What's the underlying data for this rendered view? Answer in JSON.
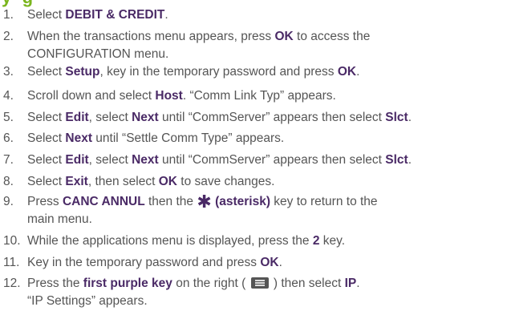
{
  "heading_fragment": "y-   g",
  "steps": [
    {
      "n": "1.",
      "parts": [
        "Select ",
        {
          "b": "DEBIT & CREDIT"
        },
        "."
      ]
    },
    {
      "n": "2.",
      "parts": [
        "When the transactions menu appears, press ",
        {
          "b": "OK"
        },
        " to access the"
      ],
      "cont": [
        "CONFIGURATION menu."
      ]
    },
    {
      "n": "3.",
      "parts": [
        "Select ",
        {
          "b": "Setup"
        },
        ", key in the temporary password and press ",
        {
          "b": "OK"
        },
        "."
      ]
    },
    {
      "n": "4.",
      "parts": [
        "Scroll down and select ",
        {
          "b": "Host"
        },
        ". “Comm Link Typ” appears."
      ]
    },
    {
      "n": "5.",
      "parts": [
        "Select ",
        {
          "b": "Edit"
        },
        ", select ",
        {
          "b": "Next"
        },
        " until “CommServer” appears then select ",
        {
          "b": "Slct"
        },
        "."
      ]
    },
    {
      "n": "6.",
      "parts": [
        "Select ",
        {
          "b": "Next"
        },
        " until “Settle Comm Type” appears."
      ]
    },
    {
      "n": "7.",
      "parts": [
        "Select ",
        {
          "b": "Edit"
        },
        ", select ",
        {
          "b": "Next"
        },
        " until “CommServer” appears then select ",
        {
          "b": "Slct"
        },
        "."
      ]
    },
    {
      "n": "8.",
      "parts": [
        "Select ",
        {
          "b": "Exit"
        },
        ", then select ",
        {
          "b": "OK"
        },
        " to save changes."
      ]
    },
    {
      "n": "9.",
      "parts": [
        "Press ",
        {
          "b": "CANC ANNUL"
        },
        " then the ",
        {
          "asterisk": "✱"
        },
        {
          "b": " (asterisk)"
        },
        " key to return to the"
      ],
      "cont": [
        "main menu."
      ]
    },
    {
      "n": "10.",
      "parts": [
        "While the applications menu is displayed, press the ",
        {
          "b": "2"
        },
        " key."
      ]
    },
    {
      "n": "11.",
      "parts": [
        "Key in the temporary password and press ",
        {
          "b": "OK"
        },
        "."
      ]
    },
    {
      "n": "12.",
      "parts": [
        "Press the ",
        {
          "b": "first purple key"
        },
        " on the right ( ",
        {
          "icon": "menu-key-icon"
        },
        " ) then select ",
        {
          "b": "IP"
        },
        "."
      ],
      "cont": [
        "“IP Settings” appears."
      ]
    }
  ]
}
